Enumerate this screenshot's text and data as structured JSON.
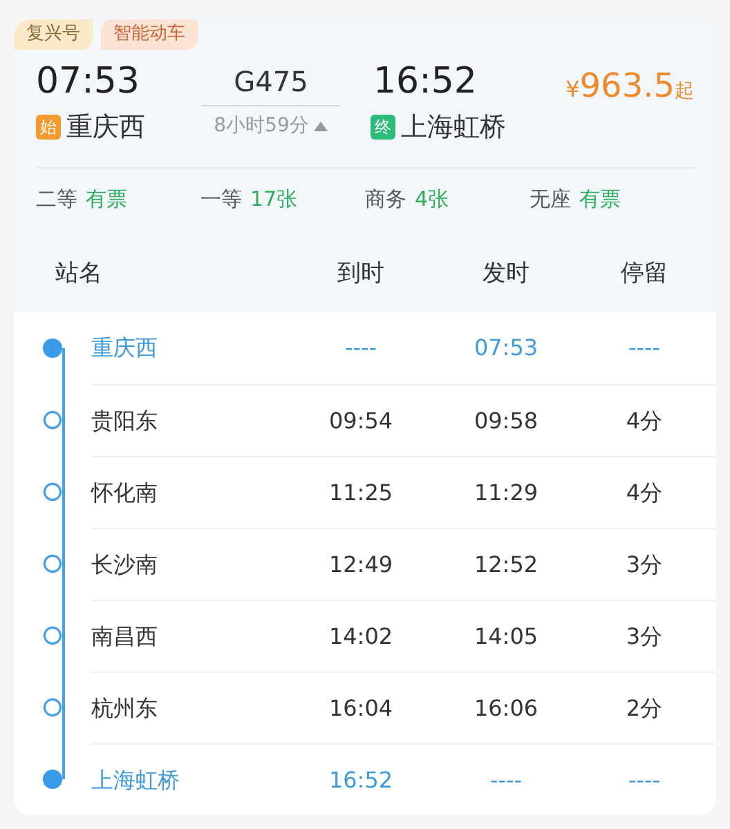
{
  "tags": [
    "复兴号",
    "智能动车"
  ],
  "train": {
    "depart_time": "07:53",
    "number": "G475",
    "arrive_time": "16:52",
    "price_symbol": "¥",
    "price": "963.5",
    "price_suffix": "起",
    "start_badge": "始",
    "from": "重庆西",
    "duration": "8小时59分",
    "end_badge": "终",
    "to": "上海虹桥"
  },
  "seats": [
    {
      "class": "二等",
      "availability": "有票"
    },
    {
      "class": "一等",
      "availability": "17张"
    },
    {
      "class": "商务",
      "availability": "4张"
    },
    {
      "class": "无座",
      "availability": "有票"
    }
  ],
  "columns": [
    "站名",
    "到时",
    "发时",
    "停留"
  ],
  "stops": [
    {
      "kind": "terminal",
      "station": "重庆西",
      "arrive": "----",
      "depart": "07:53",
      "stay": "----"
    },
    {
      "kind": "stop",
      "station": "贵阳东",
      "arrive": "09:54",
      "depart": "09:58",
      "stay": "4分"
    },
    {
      "kind": "stop",
      "station": "怀化南",
      "arrive": "11:25",
      "depart": "11:29",
      "stay": "4分"
    },
    {
      "kind": "stop",
      "station": "长沙南",
      "arrive": "12:49",
      "depart": "12:52",
      "stay": "3分"
    },
    {
      "kind": "stop",
      "station": "南昌西",
      "arrive": "14:02",
      "depart": "14:05",
      "stay": "3分"
    },
    {
      "kind": "stop",
      "station": "杭州东",
      "arrive": "16:04",
      "depart": "16:06",
      "stay": "2分"
    },
    {
      "kind": "terminal",
      "station": "上海虹桥",
      "arrive": "16:52",
      "depart": "----",
      "stay": "----"
    }
  ]
}
